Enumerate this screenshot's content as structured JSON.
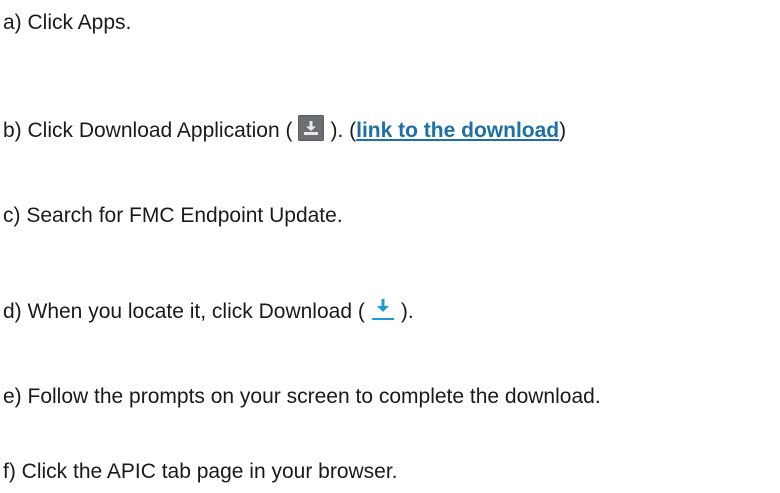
{
  "steps": {
    "a": {
      "text": "a) Click Apps."
    },
    "b": {
      "prefix": "b) Click Download Application (",
      "mid": "). (",
      "link_text": "link to the download",
      "suffix": ")",
      "icon": "download-application-icon"
    },
    "c": {
      "text": "c) Search for FMC Endpoint Update."
    },
    "d": {
      "prefix": "d) When you locate it, click Download (",
      "suffix": ").",
      "icon": "download-arrow-icon"
    },
    "e": {
      "text": "e) Follow the prompts on your screen to complete the download."
    },
    "f": {
      "text": "f) Click the APIC tab page in your browser."
    }
  },
  "colors": {
    "text": "#1a1a1a",
    "link": "#1d6fa5",
    "icon_box": "#6b6f73",
    "download_arrow": "#1e9bd7"
  }
}
